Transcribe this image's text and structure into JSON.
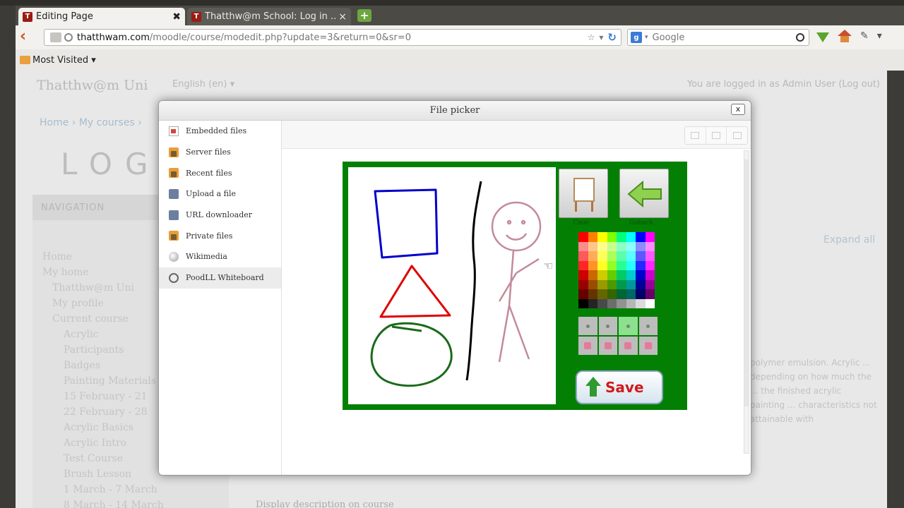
{
  "browser": {
    "tabs": [
      {
        "label": "Editing Page",
        "close": "✖"
      },
      {
        "label": "Thatthw@m School: Log in ...",
        "close": "×"
      }
    ],
    "new_tab": "+",
    "url": {
      "host": "thatthwam.com",
      "path": "/moodle/course/modedit.php?update=3&return=0&sr=0"
    },
    "search_placeholder": "Google",
    "bookmarks": {
      "most_visited": "Most Visited ▾"
    }
  },
  "page": {
    "site_name": "Thatthw@m Uni",
    "language": "English (en) ▾",
    "login_info": "You are logged in as Admin User (Log out)",
    "breadcrumb": "Home  ›  My courses  ›",
    "logo_text": "LOGO",
    "navigation": {
      "heading": "NAVIGATION",
      "items": [
        "Home",
        "My home",
        "Thatthw@m Uni",
        "My profile",
        "Current course",
        "Acrylic",
        "Participants",
        "Badges",
        "Painting Materials",
        "15 February - 21",
        "22 February - 28",
        "Acrylic Basics",
        "Acrylic Intro",
        "Test Course",
        "Brush Lesson",
        "1 March - 7 March",
        "8 March - 14 March"
      ]
    },
    "expand_all": "Expand all",
    "body_text": "polymer emulsion. Acrylic ... depending on how much the ... the finished acrylic painting ... characteristics not attainable with",
    "footer_label": "Display description on course"
  },
  "file_picker": {
    "title": "File picker",
    "close": "x",
    "repositories": [
      {
        "label": "Embedded files",
        "icon": "ri-doc"
      },
      {
        "label": "Server files",
        "icon": "ri-folder"
      },
      {
        "label": "Recent files",
        "icon": "ri-folder"
      },
      {
        "label": "Upload a file",
        "icon": "ri-up"
      },
      {
        "label": "URL downloader",
        "icon": "ri-up"
      },
      {
        "label": "Private files",
        "icon": "ri-folder"
      },
      {
        "label": "Wikimedia",
        "icon": "ri-wiki"
      },
      {
        "label": "PoodLL Whiteboard",
        "icon": "ri-wb"
      }
    ],
    "active_repository": "PoodLL Whiteboard",
    "view_modes": [
      "icons-view",
      "list-view",
      "details-view"
    ],
    "whiteboard": {
      "clear_label": "Clear",
      "goback_label": "Goback",
      "save_label": "Save",
      "drawing_colors": {
        "square": "#0000cc",
        "triangle": "#e00000",
        "circle": "#1a6a1a",
        "line": "#000000",
        "figure": "#c48a9a"
      },
      "background": "#038003"
    }
  }
}
